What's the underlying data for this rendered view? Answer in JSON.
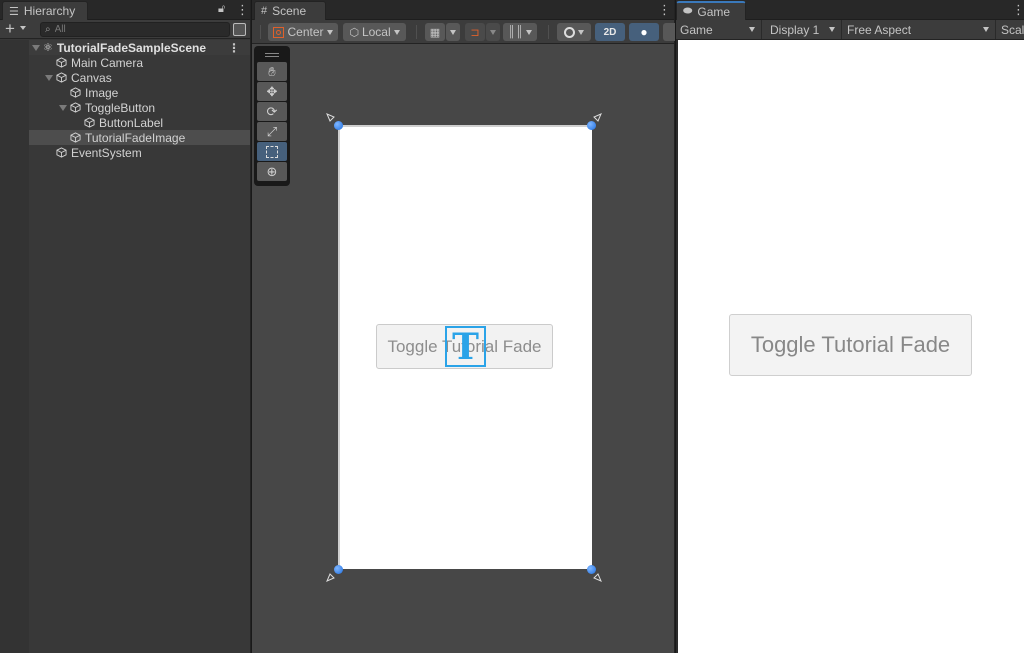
{
  "hierarchy": {
    "tab_label": "Hierarchy",
    "tab_icon": "list-icon",
    "add_label": "+",
    "search_placeholder": "All",
    "search_value": "",
    "items": [
      {
        "label": "TutorialFadeSampleScene",
        "depth": 0,
        "expanded": true,
        "type": "scene",
        "selected": false
      },
      {
        "label": "Main Camera",
        "depth": 1,
        "expanded": null,
        "type": "gameobject",
        "selected": false
      },
      {
        "label": "Canvas",
        "depth": 1,
        "expanded": true,
        "type": "gameobject",
        "selected": false
      },
      {
        "label": "Image",
        "depth": 2,
        "expanded": null,
        "type": "gameobject",
        "selected": false
      },
      {
        "label": "ToggleButton",
        "depth": 2,
        "expanded": true,
        "type": "gameobject",
        "selected": false
      },
      {
        "label": "ButtonLabel",
        "depth": 3,
        "expanded": null,
        "type": "gameobject",
        "selected": false
      },
      {
        "label": "TutorialFadeImage",
        "depth": 2,
        "expanded": null,
        "type": "gameobject",
        "selected": true
      },
      {
        "label": "EventSystem",
        "depth": 1,
        "expanded": null,
        "type": "gameobject",
        "selected": false
      }
    ]
  },
  "scene": {
    "tab_label": "Scene",
    "tab_icon": "grid-hash-icon",
    "toolbar": {
      "pivot_label": "Center",
      "space_label": "Local",
      "mode_2d_label": "2D"
    },
    "tools": [
      "hand-tool",
      "move-tool",
      "rotate-tool",
      "scale-tool",
      "rect-tool",
      "transform-tool"
    ],
    "active_tool": "rect-tool",
    "button_label": "Toggle Tutorial Fade",
    "gizmo_glyph": "T"
  },
  "game": {
    "tab_label": "Game",
    "tab_icon": "gamepad-icon",
    "toolbar": {
      "view_label": "Game",
      "display_label": "Display 1",
      "aspect_label": "Free Aspect",
      "scale_label": "Scal"
    },
    "button_label": "Toggle Tutorial Fade"
  },
  "colors": {
    "accent_blue": "#46607c",
    "handle_blue": "#1f6fe0",
    "gizmo_blue": "#2aa3e8",
    "tab_highlight": "#3a79bb"
  }
}
